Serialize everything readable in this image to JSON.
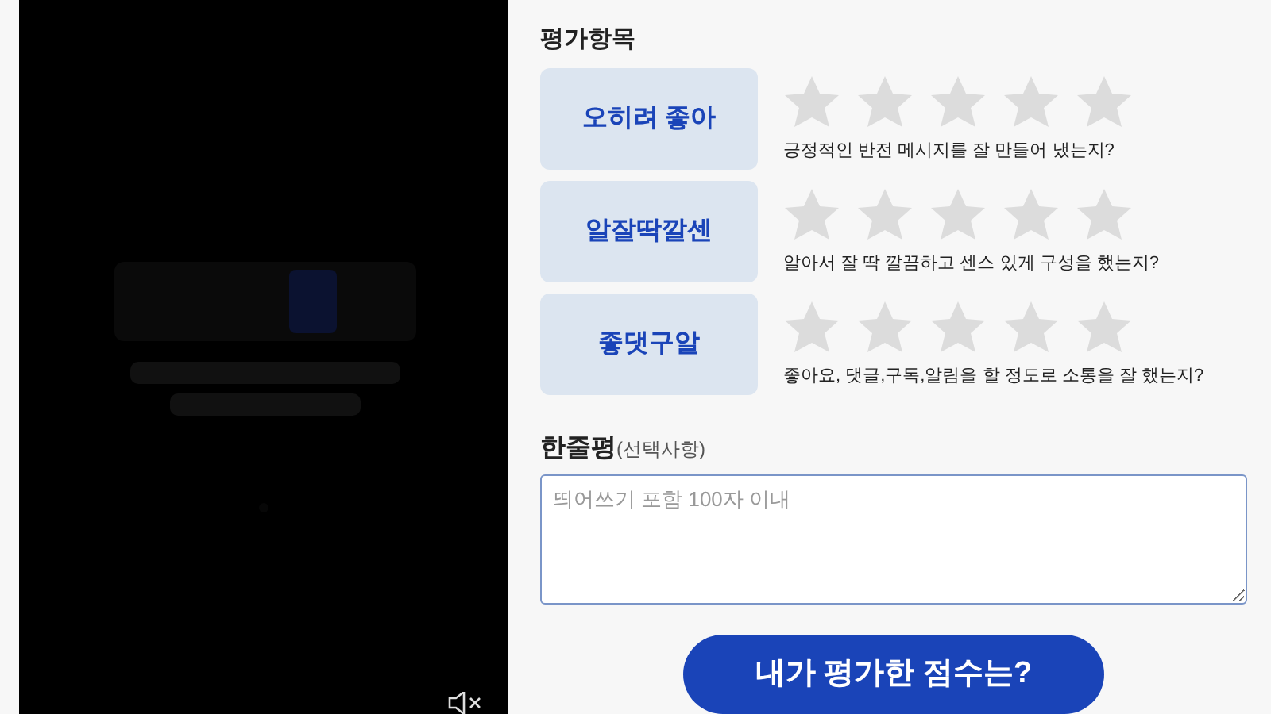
{
  "video": {
    "kind": "picture",
    "muted": true
  },
  "section_title": "평가항목",
  "criteria": [
    {
      "label": "오히려 좋아",
      "stars": 0,
      "question": "긍정적인 반전 메시지를 잘 만들어 냈는지?"
    },
    {
      "label": "알잘딱깔센",
      "stars": 0,
      "question": "알아서 잘 딱 깔끔하고 센스 있게 구성을 했는지?"
    },
    {
      "label": "좋댓구알",
      "stars": 0,
      "question": "좋아요, 댓글,구독,알림을 할 정도로 소통을 잘 했는지?"
    }
  ],
  "review": {
    "title": "한줄평",
    "note": "(선택사항)",
    "placeholder": "띄어쓰기 포함 100자 이내"
  },
  "submit": "내가 평가한 점수는?"
}
